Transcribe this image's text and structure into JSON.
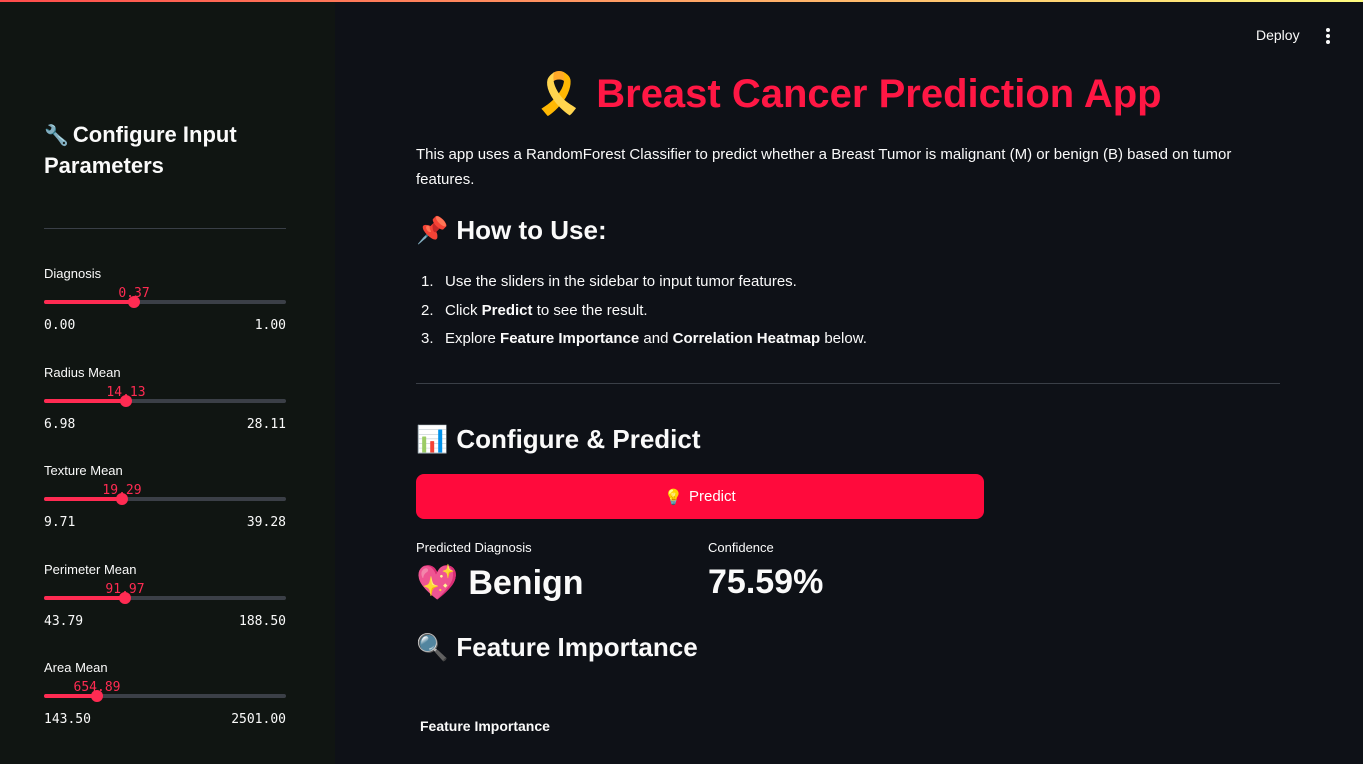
{
  "header": {
    "deploy_label": "Deploy",
    "menu_icon": "kebab-menu-icon",
    "stripe_colors": [
      "#ff4b4b",
      "#fffd80"
    ]
  },
  "sidebar": {
    "title_icon": "🔧",
    "title": "Configure Input Parameters",
    "sliders": [
      {
        "label": "Diagnosis",
        "value": "0.37",
        "min": "0.00",
        "max": "1.00",
        "fraction": 0.37
      },
      {
        "label": "Radius Mean",
        "value": "14.13",
        "min": "6.98",
        "max": "28.11",
        "fraction": 0.338
      },
      {
        "label": "Texture Mean",
        "value": "19.29",
        "min": "9.71",
        "max": "39.28",
        "fraction": 0.324
      },
      {
        "label": "Perimeter Mean",
        "value": "91.97",
        "min": "43.79",
        "max": "188.50",
        "fraction": 0.333
      },
      {
        "label": "Area Mean",
        "value": "654.89",
        "min": "143.50",
        "max": "2501.00",
        "fraction": 0.217
      }
    ]
  },
  "main": {
    "title_icon": "🎗️",
    "title": "Breast Cancer Prediction App",
    "description": "This app uses a RandomForest Classifier to predict whether a Breast Tumor is malignant (M) or benign (B) based on tumor features.",
    "how_to": {
      "icon": "📌",
      "heading": "How to Use:",
      "steps": [
        {
          "num": "1.",
          "text_a": "Use the sliders in the sidebar to input tumor features.",
          "bold_a": "",
          "text_b": "",
          "bold_b": "",
          "text_c": ""
        },
        {
          "num": "2.",
          "text_a": "Click ",
          "bold_a": "Predict",
          "text_b": " to see the result.",
          "bold_b": "",
          "text_c": ""
        },
        {
          "num": "3.",
          "text_a": "Explore ",
          "bold_a": "Feature Importance",
          "text_b": " and ",
          "bold_b": "Correlation Heatmap",
          "text_c": " below."
        }
      ]
    },
    "configure": {
      "icon": "📊",
      "heading": "Configure & Predict",
      "button_icon": "💡",
      "button_label": "Predict"
    },
    "result": {
      "diagnosis_label": "Predicted Diagnosis",
      "diagnosis_icon": "💖",
      "diagnosis_value": "Benign",
      "confidence_label": "Confidence",
      "confidence_value": "75.59%"
    },
    "feature_importance": {
      "icon": "🔍",
      "heading": "Feature Importance",
      "chart_title": "Feature Importance"
    }
  },
  "colors": {
    "background": "#0e1117",
    "sidebar_bg": "#101512",
    "accent": "#ff2b52",
    "title_red": "#ff1744",
    "button_red": "#ff0a3c"
  }
}
